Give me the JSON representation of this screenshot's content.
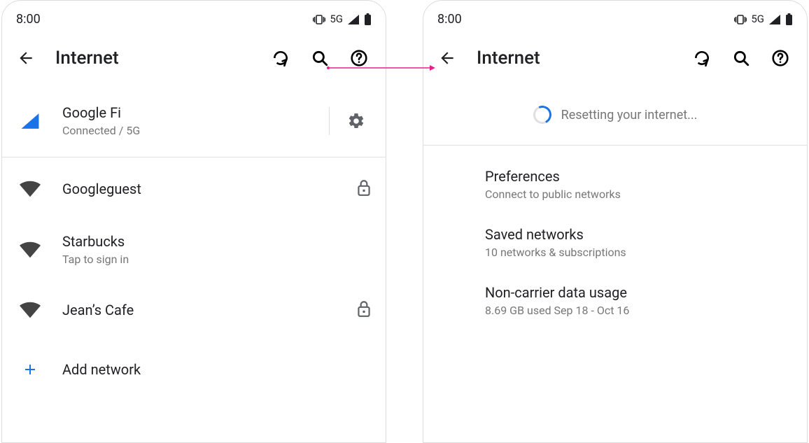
{
  "status": {
    "time": "8:00",
    "net_label": "5G"
  },
  "appbar": {
    "title": "Internet"
  },
  "left": {
    "mobile": {
      "name": "Google Fi",
      "status": "Connected / 5G"
    },
    "wifi": [
      {
        "name": "Googleguest",
        "locked": true
      },
      {
        "name": "Starbucks",
        "sub": "Tap to sign in",
        "locked": false
      },
      {
        "name": "Jean’s Cafe",
        "locked": true
      }
    ],
    "add_label": "Add network"
  },
  "right": {
    "resetting": "Resetting your internet...",
    "prefs": {
      "title": "Preferences",
      "sub": "Connect to public networks"
    },
    "saved": {
      "title": "Saved networks",
      "sub": "10 networks & subscriptions"
    },
    "usage": {
      "title": "Non-carrier data usage",
      "sub": "8.69 GB used Sep 18 - Oct 16"
    }
  }
}
